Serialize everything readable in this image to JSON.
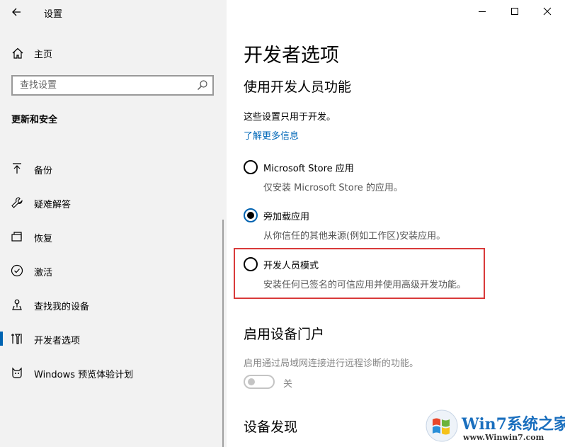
{
  "app": {
    "title": "设置"
  },
  "sidebar": {
    "home_label": "主页",
    "search_placeholder": "查找设置",
    "section_title": "更新和安全",
    "items": [
      {
        "label": "备份",
        "icon": "backup-arrow-icon"
      },
      {
        "label": "疑难解答",
        "icon": "wrench-icon"
      },
      {
        "label": "恢复",
        "icon": "recovery-icon"
      },
      {
        "label": "激活",
        "icon": "check-circle-icon"
      },
      {
        "label": "查找我的设备",
        "icon": "person-pin-icon"
      },
      {
        "label": "开发者选项",
        "icon": "developer-tools-icon",
        "selected": true
      },
      {
        "label": "Windows 预览体验计划",
        "icon": "insider-cat-icon"
      }
    ]
  },
  "main": {
    "page_title": "开发者选项",
    "dev_features": {
      "heading": "使用开发人员功能",
      "description": "这些设置只用于开发。",
      "learn_more": "了解更多信息",
      "options": [
        {
          "label": "Microsoft Store 应用",
          "description": "仅安装 Microsoft Store 的应用。",
          "checked": false
        },
        {
          "label": "旁加载应用",
          "description": "从你信任的其他来源(例如工作区)安装应用。",
          "checked": true
        },
        {
          "label": "开发人员模式",
          "description": "安装任何已签名的可信应用并使用高级开发功能。",
          "checked": false
        }
      ]
    },
    "device_portal": {
      "heading": "启用设备门户",
      "description": "启用通过局域网连接进行远程诊断的功能。",
      "toggle_state": "关"
    },
    "device_discovery": {
      "heading": "设备发现"
    }
  },
  "watermark": {
    "title": "Win7系统之家",
    "url": "www.Winwin7.com"
  },
  "colors": {
    "accent": "#0063b1",
    "link": "#0067b8",
    "highlight": "#d93a3a",
    "sidebar_bg": "#f2f2f2"
  }
}
